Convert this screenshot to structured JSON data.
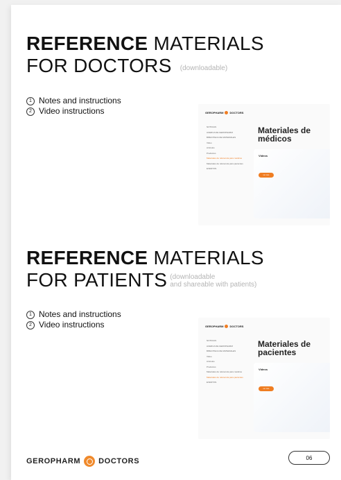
{
  "doctors": {
    "title_bold": "REFERENCE",
    "title_rest": " MATERIALS",
    "title_line2": "FOR DOCTORS",
    "title_note": "(downloadable)",
    "items": [
      {
        "num": "1",
        "label": "Notes and instructions"
      },
      {
        "num": "2",
        "label": "Video instructions"
      }
    ],
    "screenshot": {
      "brand_left": "GEROPHARM",
      "brand_right": "DOCTORS",
      "heading_line1": "Materiales de",
      "heading_line2": "médicos",
      "panel_title": "Videos",
      "button_label": "ver mas",
      "nav": [
        "NOTICIAS",
        "ACERCA DE GEROPHARM",
        "BIBLIOTECA DE MATERIALES",
        "Video",
        "Artículos",
        "Productos",
        "Materiales de referencia para médicos",
        "Materiales de referencia para pacientes",
        "EVENTOS"
      ]
    }
  },
  "patients": {
    "title_bold": "REFERENCE",
    "title_rest": " MATERIALS",
    "title_line2": "FOR PATIENTS",
    "title_note_line1": "(downloadable",
    "title_note_line2": "and shareable with patients)",
    "items": [
      {
        "num": "1",
        "label": "Notes and instructions"
      },
      {
        "num": "2",
        "label": "Video instructions"
      }
    ],
    "screenshot": {
      "brand_left": "GEROPHARM",
      "brand_right": "DOCTORS",
      "heading_line1": "Materiales de",
      "heading_line2": "pacientes",
      "panel_title": "Videos",
      "button_label": "ver mas",
      "nav": [
        "NOTICIAS",
        "ACERCA DE GEROPHARM",
        "BIBLIOTECA DE MATERIALES",
        "Video",
        "Artículos",
        "Productos",
        "Materiales de referencia para médicos",
        "Materiales de referencia para pacientes",
        "EVENTOS"
      ]
    }
  },
  "footer": {
    "brand_left": "GEROPHARM",
    "brand_right": "DOCTORS",
    "page_number": "06"
  },
  "colors": {
    "accent": "#ef7d22",
    "text": "#111111",
    "muted": "#b4b4b4"
  }
}
